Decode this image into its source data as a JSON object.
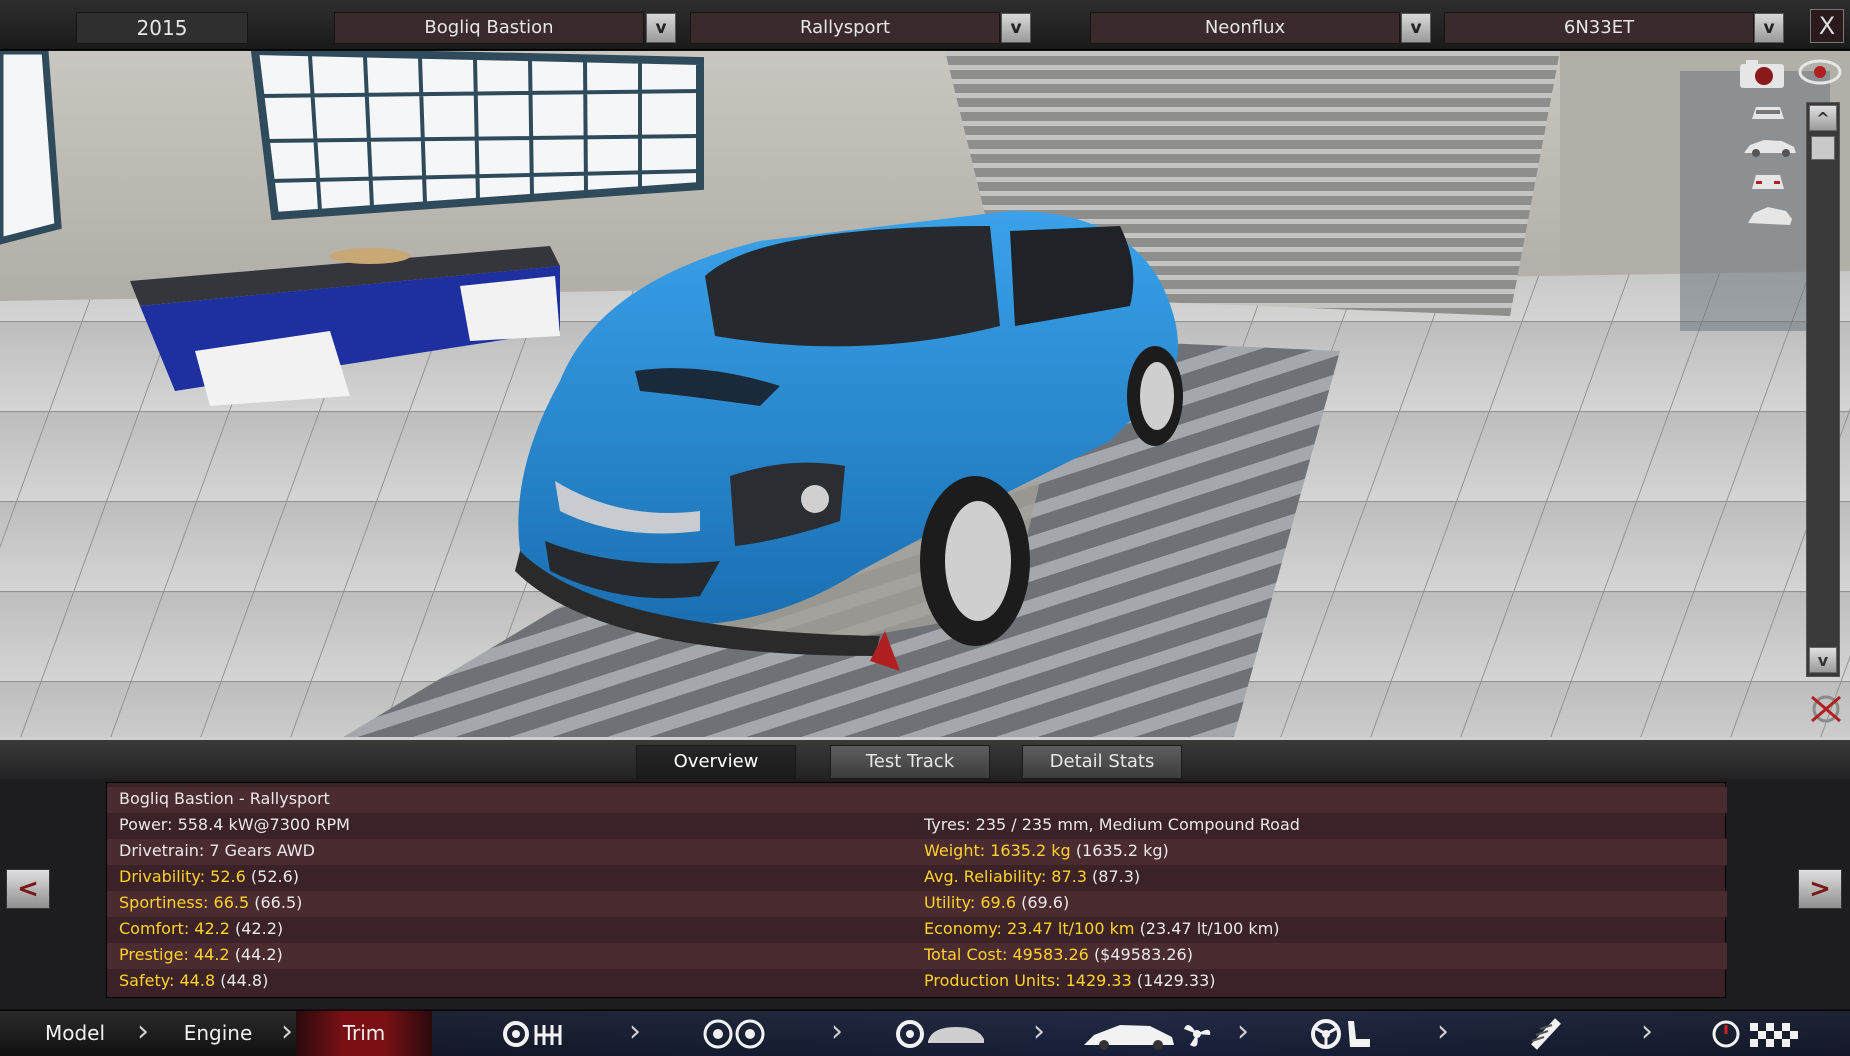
{
  "topbar": {
    "year": "2015",
    "model": "Bogliq Bastion",
    "trim": "Rallysport",
    "company": "Neonflux",
    "code": "6N33ET",
    "dropdown_glyph": "v",
    "close_glyph": "X"
  },
  "scroll": {
    "up": "^",
    "down": "v"
  },
  "tabs": {
    "overview": "Overview",
    "test_track": "Test Track",
    "detail_stats": "Detail Stats"
  },
  "stats": {
    "title": "Bogliq Bastion - Rallysport",
    "power": "Power: 558.4 kW@7300 RPM",
    "drivetrain": "Drivetrain: 7 Gears AWD",
    "drivability_label": "Drivability: 52.6",
    "drivability_val": "(52.6)",
    "sportiness_label": "Sportiness: 66.5",
    "sportiness_val": "(66.5)",
    "comfort_label": "Comfort: 42.2",
    "comfort_val": "(42.2)",
    "prestige_label": "Prestige: 44.2",
    "prestige_val": "(44.2)",
    "safety_label": "Safety: 44.8",
    "safety_val": "(44.8)",
    "tyres": "Tyres: 235 / 235 mm, Medium Compound Road",
    "weight_label": "Weight: 1635.2 kg",
    "weight_val": "(1635.2 kg)",
    "reliability_label": "Avg. Reliability: 87.3",
    "reliability_val": "(87.3)",
    "utility_label": "Utility: 69.6",
    "utility_val": "(69.6)",
    "economy_label": "Economy: 23.47 lt/100 km",
    "economy_val": "(23.47 lt/100 km)",
    "cost_label": "Total Cost: 49583.26",
    "cost_val": "($49583.26)",
    "units_label": "Production Units: 1429.33",
    "units_val": "(1429.33)"
  },
  "nav": {
    "prev": "<",
    "next": ">"
  },
  "steps": {
    "model": "Model",
    "engine": "Engine",
    "trim": "Trim"
  },
  "icons": [
    "camera-icon",
    "eye-icon",
    "car-front-view-icon",
    "car-side-view-icon",
    "car-rear-view-icon",
    "car-angle-view-icon",
    "hide-icon",
    "gearbox-icon",
    "wheels-icon",
    "brake-icon",
    "body-aero-icon",
    "fan-icon",
    "steering-wheel-icon",
    "seat-icon",
    "suspension-icon",
    "speedometer-icon",
    "checkered-flag-icon"
  ],
  "colors": {
    "car_body": "#2a8fd6",
    "accent_red": "#7a1014",
    "highlight_yellow": "#ffd22a",
    "panel_bg": "#3a2226"
  }
}
